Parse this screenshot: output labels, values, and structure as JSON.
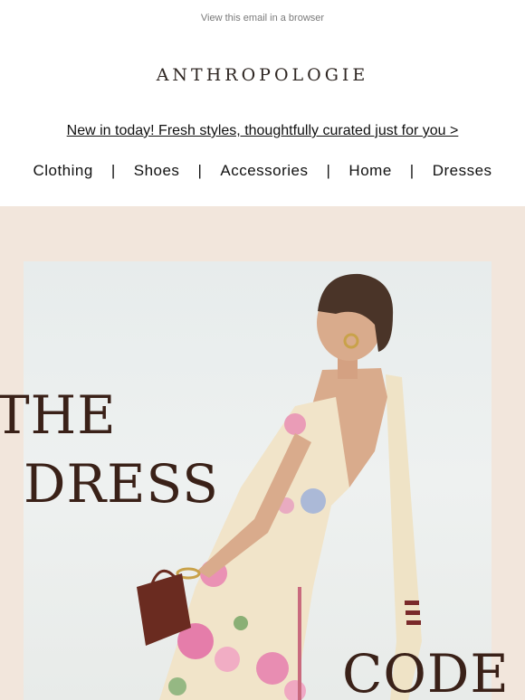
{
  "header": {
    "view_in_browser": "View this email in a browser",
    "brand": "ANTHROPOLOGIE"
  },
  "promo": {
    "text": "New in today! Fresh styles, thoughtfully curated just for you >"
  },
  "nav": {
    "items": [
      "Clothing",
      "Shoes",
      "Accessories",
      "Home",
      "Dresses"
    ],
    "separator": "|"
  },
  "hero": {
    "headline_line1": "THE",
    "headline_line2": "DRESS",
    "headline_line3": "CODE"
  },
  "colors": {
    "hero_background": "#f2e6dc",
    "headline": "#3a2118",
    "brand_text": "#2e2622"
  }
}
